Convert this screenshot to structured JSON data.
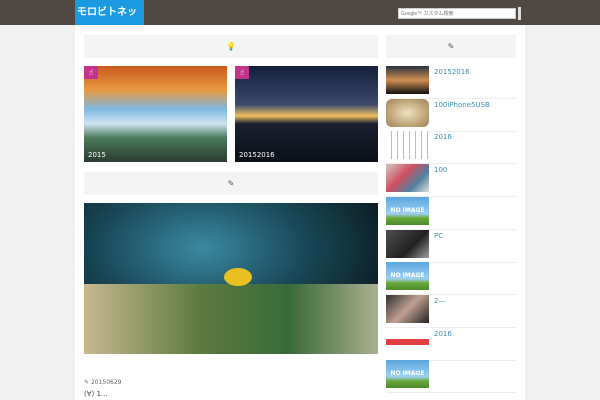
{
  "header": {
    "logo": "モロビトネット",
    "search_placeholder": "Google™ カスタム検索"
  },
  "main": {
    "section1_icon": "lightbulb-icon",
    "cards": [
      {
        "caption": "2015"
      },
      {
        "caption": "20152016"
      }
    ],
    "section2_icon": "pencil-icon",
    "post": {
      "date": "20150629",
      "excerpt": "(∀) 1..."
    }
  },
  "sidebar": {
    "header_icon": "pencil-icon",
    "items": [
      {
        "label": "20152016",
        "thumb": "sunset"
      },
      {
        "label": "100iPhone5USB",
        "thumb": "cable"
      },
      {
        "label": "2016",
        "thumb": "calendar"
      },
      {
        "label": "100",
        "thumb": "bag"
      },
      {
        "label": "",
        "thumb": "noimage"
      },
      {
        "label": "PC",
        "thumb": "keyboard"
      },
      {
        "label": "",
        "thumb": "noimage"
      },
      {
        "label": "2—",
        "thumb": "hand"
      },
      {
        "label": "2016",
        "thumb": "calendar-red"
      },
      {
        "label": "",
        "thumb": "noimage"
      }
    ],
    "noimage_text": "NO IMAGE"
  }
}
